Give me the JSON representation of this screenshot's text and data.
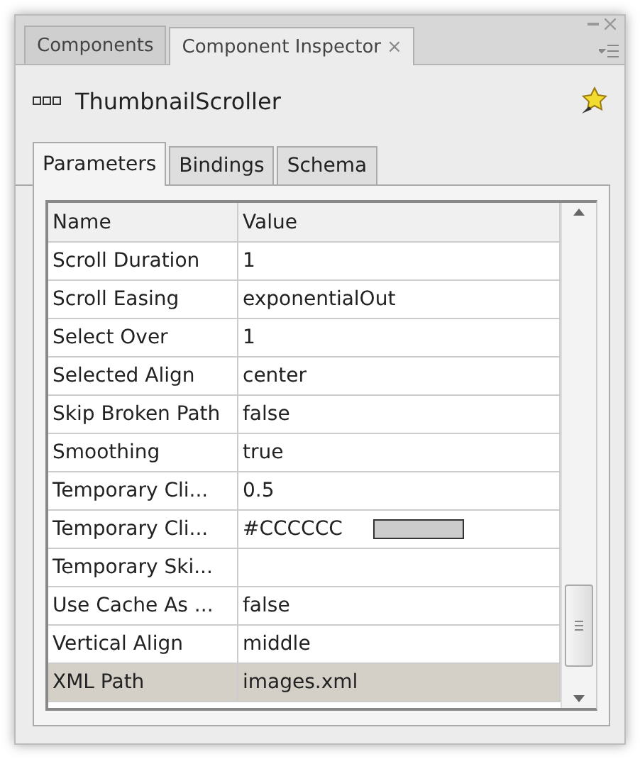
{
  "panel_tabs": [
    {
      "label": "Components",
      "selected": false,
      "closable": false
    },
    {
      "label": "Component Inspector",
      "selected": true,
      "closable": true
    }
  ],
  "close_glyph": "×",
  "component": {
    "name": "ThumbnailScroller"
  },
  "tabs": [
    {
      "label": "Parameters",
      "selected": true
    },
    {
      "label": "Bindings",
      "selected": false
    },
    {
      "label": "Schema",
      "selected": false
    }
  ],
  "table": {
    "columns": [
      "Name",
      "Value"
    ],
    "rows": [
      {
        "name": "Scroll Duration",
        "value": "1",
        "kind": "text",
        "selected": false
      },
      {
        "name": "Scroll Easing",
        "value": "exponentialOut",
        "kind": "text",
        "selected": false
      },
      {
        "name": "Select Over",
        "value": "1",
        "kind": "text",
        "selected": false
      },
      {
        "name": "Selected Align",
        "value": "center",
        "kind": "text",
        "selected": false
      },
      {
        "name": "Skip Broken Path",
        "value": "false",
        "kind": "text",
        "selected": false
      },
      {
        "name": "Smoothing",
        "value": "true",
        "kind": "text",
        "selected": false
      },
      {
        "name": "Temporary Cli...",
        "value": "0.5",
        "kind": "text",
        "selected": false
      },
      {
        "name": "Temporary Cli...",
        "value": "#CCCCCC",
        "kind": "color",
        "color": "#cccccc",
        "selected": false
      },
      {
        "name": "Temporary Ski...",
        "kind": "text",
        "selected": false
      },
      {
        "name": "Use Cache As ...",
        "value": "false",
        "kind": "text",
        "selected": false
      },
      {
        "name": "Vertical Align",
        "value": "middle",
        "kind": "text",
        "selected": false
      },
      {
        "name": "XML Path",
        "value": "images.xml",
        "kind": "text",
        "selected": true
      }
    ]
  }
}
